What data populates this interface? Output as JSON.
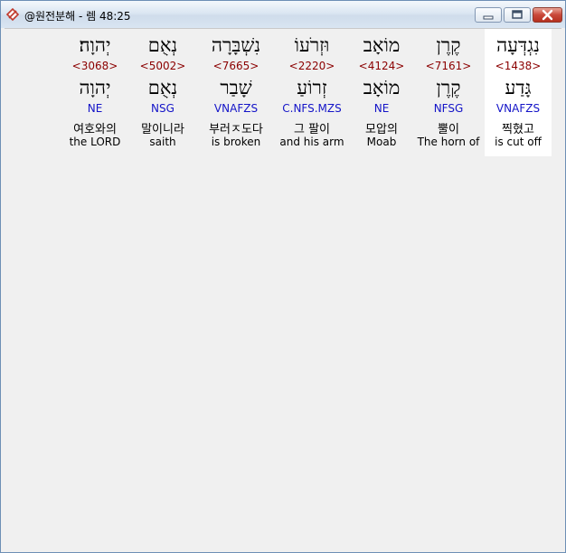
{
  "window": {
    "title": "@원전분해 - 렘 48:25"
  },
  "columns": [
    {
      "hebrew": "נִגְדְּעָה",
      "strong": "<1438>",
      "root": "גָּדַע",
      "parse": "VNAFZS",
      "korean": "찍혔고",
      "english": "is cut off",
      "selected": true
    },
    {
      "hebrew": "קֶרֶן",
      "strong": "<7161>",
      "root": "קֶרֶן",
      "parse": "NFSG",
      "korean": "뿔이",
      "english": "The horn of",
      "selected": false
    },
    {
      "hebrew": "מוֹאָב",
      "strong": "<4124>",
      "root": "מוֹאָב",
      "parse": "NE",
      "korean": "모압의",
      "english": "Moab",
      "selected": false
    },
    {
      "hebrew": "וּזְרֹעוֹ",
      "strong": "<2220>",
      "root": "זְרוֹעַ",
      "parse": "C.NFS.MZS",
      "korean": "그 팔이",
      "english": "and his arm",
      "selected": false
    },
    {
      "hebrew": "נִשְׁבָּרָה",
      "strong": "<7665>",
      "root": "שָׁבַר",
      "parse": "VNAFZS",
      "korean": "부러ㅈ도다",
      "english": "is broken",
      "selected": false
    },
    {
      "hebrew": "נְאֻם",
      "strong": "<5002>",
      "root": "נְאֻם",
      "parse": "NSG",
      "korean": "말이니라",
      "english": "saith",
      "selected": false
    },
    {
      "hebrew": "יְהוָה׃",
      "strong": "<3068>",
      "root": "יְהוָה",
      "parse": "NE",
      "korean": "여호와의",
      "english": "the LORD",
      "selected": false
    }
  ]
}
